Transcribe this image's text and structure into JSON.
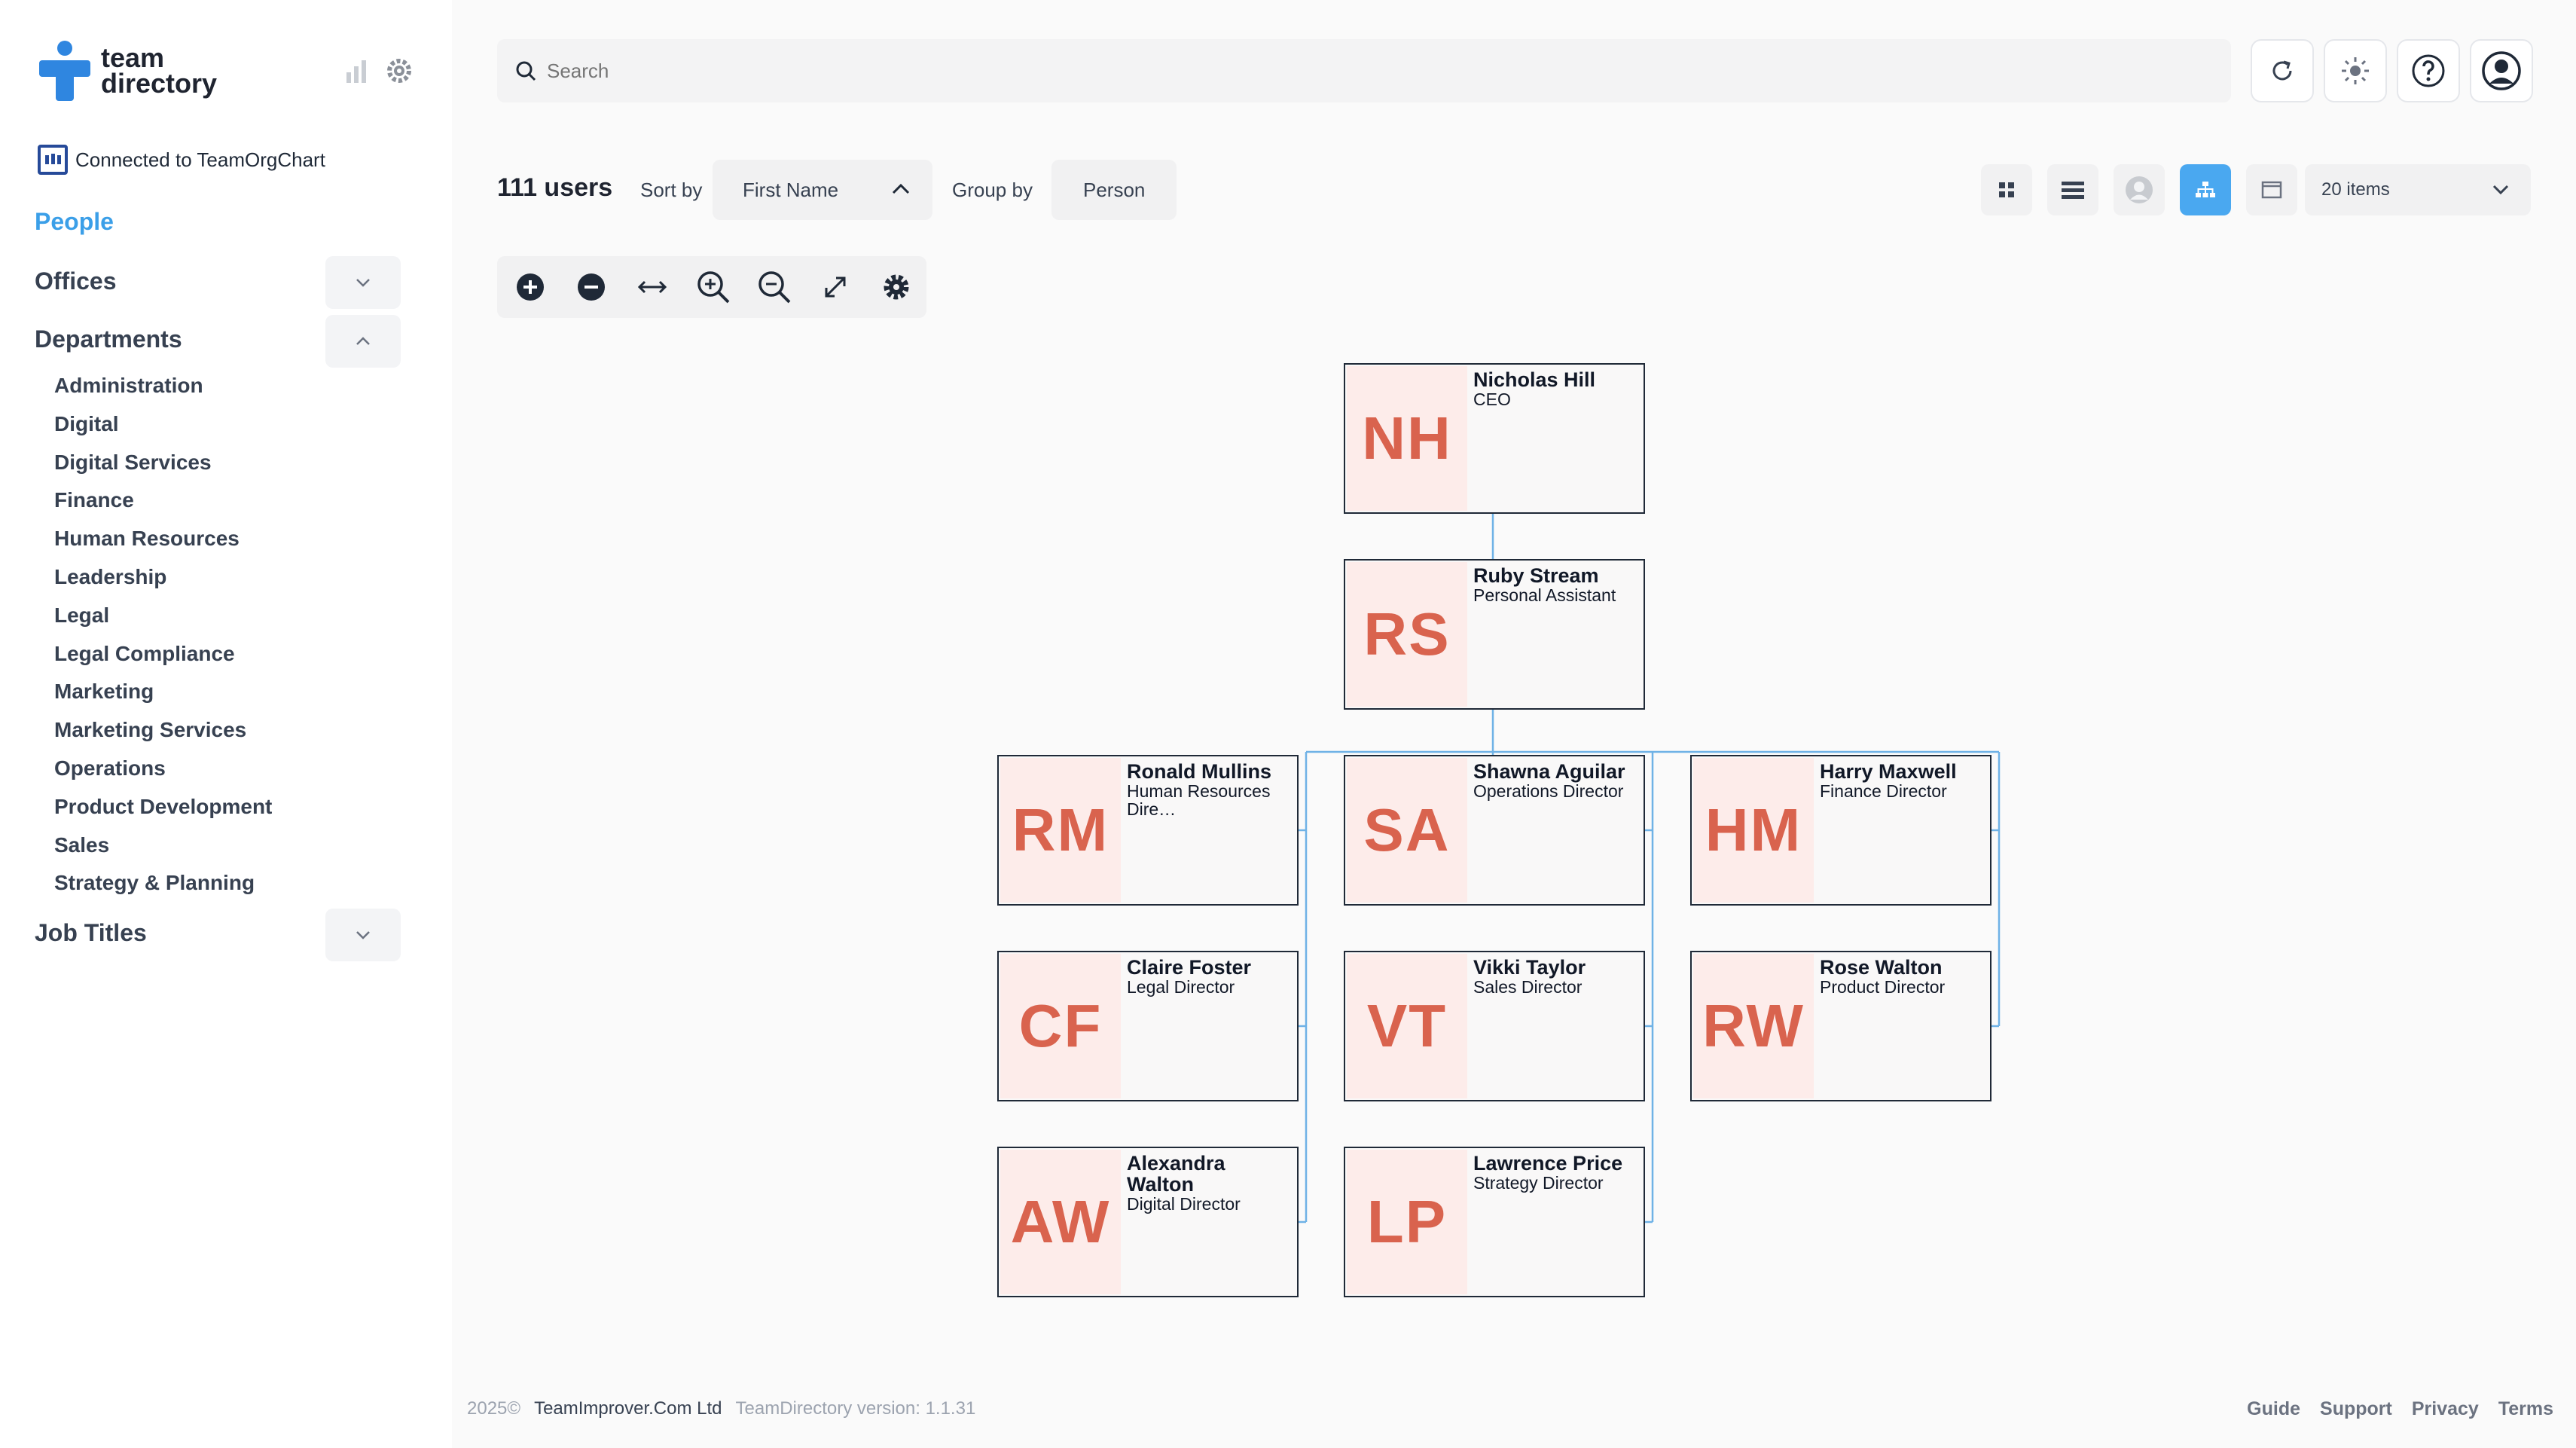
{
  "app": {
    "logo_line1": "team",
    "logo_line2": "directory",
    "connected_label": "Connected to TeamOrgChart"
  },
  "sidebar": {
    "people_label": "People",
    "offices_label": "Offices",
    "departments_label": "Departments",
    "job_titles_label": "Job Titles",
    "departments": [
      "Administration",
      "Digital",
      "Digital Services",
      "Finance",
      "Human Resources",
      "Leadership",
      "Legal",
      "Legal Compliance",
      "Marketing",
      "Marketing Services",
      "Operations",
      "Product Development",
      "Sales",
      "Strategy & Planning"
    ]
  },
  "search": {
    "placeholder": "Search"
  },
  "toolbar": {
    "user_count": "111 users",
    "sort_label": "Sort by",
    "sort_value": "First Name",
    "group_label": "Group by",
    "group_value": "Person",
    "items_value": "20 items"
  },
  "org": {
    "root": {
      "initials": "NH",
      "name": "Nicholas Hill",
      "role": "CEO"
    },
    "assistant": {
      "initials": "RS",
      "name": "Ruby Stream",
      "role": "Personal Assistant"
    },
    "reports": [
      {
        "initials": "RM",
        "name": "Ronald Mullins",
        "role": "Human Resources Dire…"
      },
      {
        "initials": "SA",
        "name": "Shawna Aguilar",
        "role": "Operations Director"
      },
      {
        "initials": "HM",
        "name": "Harry Maxwell",
        "role": "Finance Director"
      },
      {
        "initials": "CF",
        "name": "Claire Foster",
        "role": "Legal Director"
      },
      {
        "initials": "VT",
        "name": "Vikki Taylor",
        "role": "Sales Director"
      },
      {
        "initials": "RW",
        "name": "Rose Walton",
        "role": "Product Director"
      },
      {
        "initials": "AW",
        "name": "Alexandra Walton",
        "role": "Digital Director"
      },
      {
        "initials": "LP",
        "name": "Lawrence Price",
        "role": "Strategy Director"
      }
    ]
  },
  "footer": {
    "year": "2025©",
    "company": "TeamImprover.Com Ltd",
    "version": "TeamDirectory version: 1.1.31",
    "links": [
      "Guide",
      "Support",
      "Privacy",
      "Terms"
    ]
  },
  "colors": {
    "accent": "#3b9fe8",
    "avatar_bg": "#fdecea",
    "avatar_text": "#d9634e",
    "connector": "#6fb2e6"
  }
}
